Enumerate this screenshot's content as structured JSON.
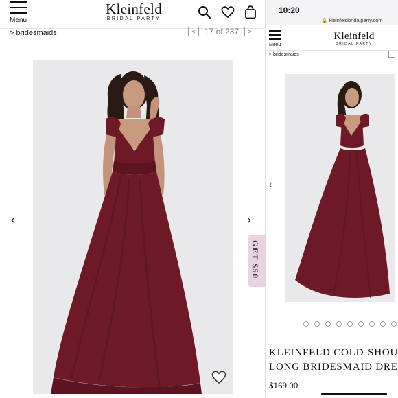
{
  "brand": {
    "name": "Kleinfeld",
    "subtitle": "BRIDAL PARTY"
  },
  "left": {
    "menu_label": "Menu",
    "breadcrumb": "> bridesmaids",
    "pager": {
      "text": "17 of 237",
      "prev_symbol": "<",
      "next_symbol": ">"
    },
    "carousel": {
      "prev_symbol": "‹",
      "next_symbol": "›"
    },
    "promo_tab": "GET $50",
    "icons": [
      "search-icon",
      "heart-icon",
      "shopping-bag-icon"
    ]
  },
  "right": {
    "status_time": "10:20",
    "url": "kleinfeldbridalparty.com",
    "menu_label": "Menu",
    "breadcrumb": "> bridesmaids",
    "product_title_line1": "KLEINFELD COLD-SHOU",
    "product_title_line2": "LONG BRIDESMAID DRE",
    "price": "$169.00",
    "carousel": {
      "prev_symbol": "‹",
      "dot_count": 10
    }
  },
  "colors": {
    "dress": "#6e1a26",
    "backdrop": "#e9e9eb",
    "promo": "#e8d4e0"
  }
}
